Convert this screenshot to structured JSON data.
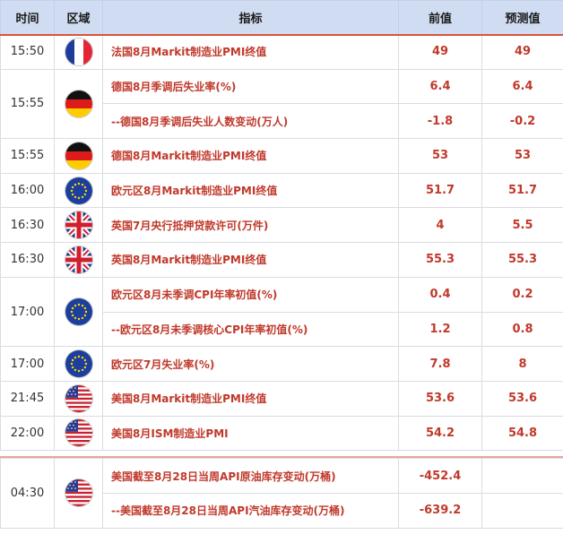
{
  "header": {
    "time": "时间",
    "region": "区域",
    "indicator": "指标",
    "previous": "前值",
    "forecast": "预测值"
  },
  "groups": [
    {
      "time": "15:50",
      "flag": "france-flag-icon",
      "rows": [
        {
          "indicator": "法国8月Markit制造业PMI终值",
          "previous": "49",
          "forecast": "49"
        }
      ]
    },
    {
      "time": "15:55",
      "flag": "germany-flag-icon",
      "rows": [
        {
          "indicator": "德国8月季调后失业率(%)",
          "previous": "6.4",
          "forecast": "6.4"
        },
        {
          "indicator": "--德国8月季调后失业人数变动(万人)",
          "previous": "-1.8",
          "forecast": "-0.2"
        }
      ]
    },
    {
      "time": "15:55",
      "flag": "germany-flag-icon",
      "rows": [
        {
          "indicator": "德国8月Markit制造业PMI终值",
          "previous": "53",
          "forecast": "53"
        }
      ]
    },
    {
      "time": "16:00",
      "flag": "eu-flag-icon",
      "rows": [
        {
          "indicator": "欧元区8月Markit制造业PMI终值",
          "previous": "51.7",
          "forecast": "51.7"
        }
      ]
    },
    {
      "time": "16:30",
      "flag": "uk-flag-icon",
      "rows": [
        {
          "indicator": "英国7月央行抵押贷款许可(万件)",
          "previous": "4",
          "forecast": "5.5"
        }
      ]
    },
    {
      "time": "16:30",
      "flag": "uk-flag-icon",
      "rows": [
        {
          "indicator": "英国8月Markit制造业PMI终值",
          "previous": "55.3",
          "forecast": "55.3"
        }
      ]
    },
    {
      "time": "17:00",
      "flag": "eu-flag-icon",
      "rows": [
        {
          "indicator": "欧元区8月未季调CPI年率初值(%)",
          "previous": "0.4",
          "forecast": "0.2"
        },
        {
          "indicator": "--欧元区8月未季调核心CPI年率初值(%)",
          "previous": "1.2",
          "forecast": "0.8"
        }
      ]
    },
    {
      "time": "17:00",
      "flag": "eu-flag-icon",
      "rows": [
        {
          "indicator": "欧元区7月失业率(%)",
          "previous": "7.8",
          "forecast": "8"
        }
      ]
    },
    {
      "time": "21:45",
      "flag": "usa-flag-icon",
      "rows": [
        {
          "indicator": "美国8月Markit制造业PMI终值",
          "previous": "53.6",
          "forecast": "53.6"
        }
      ]
    },
    {
      "time": "22:00",
      "flag": "usa-flag-icon",
      "rows": [
        {
          "indicator": "美国8月ISM制造业PMI",
          "previous": "54.2",
          "forecast": "54.8"
        }
      ]
    }
  ],
  "night_group": {
    "time": "04:30",
    "flag": "usa-flag-icon",
    "rows": [
      {
        "indicator": "美国截至8月28日当周API原油库存变动(万桶)",
        "previous": "-452.4",
        "forecast": ""
      },
      {
        "indicator": "--美国截至8月28日当周API汽油库存变动(万桶)",
        "previous": "-639.2",
        "forecast": ""
      }
    ]
  },
  "colors": {
    "accent": "#c0392b",
    "header_bg": "#cfdcf1",
    "header_line": "#d9533b"
  }
}
